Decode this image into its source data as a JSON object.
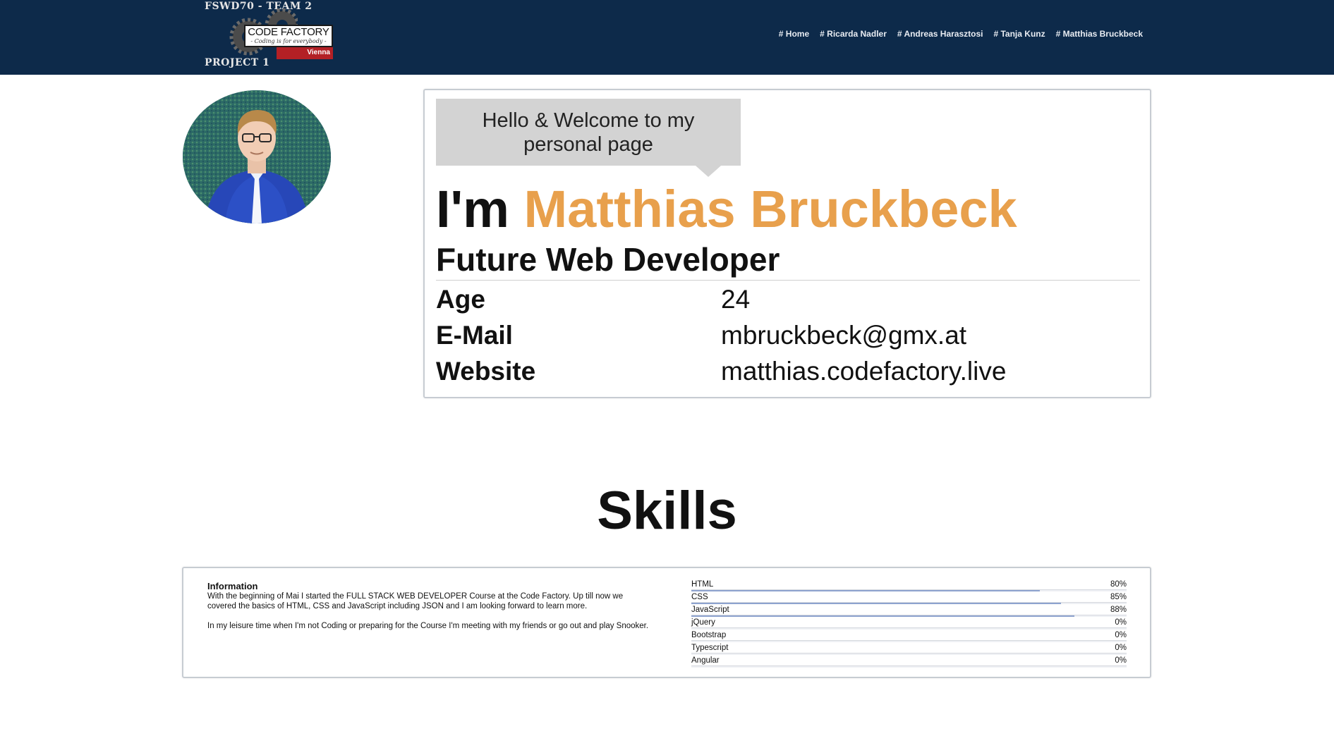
{
  "header": {
    "logo": {
      "top_text": "FSWD70 - TEAM 2",
      "card_title": "CODE FACTORY",
      "card_subtitle": "- Coding is for everybody -",
      "bar_text": "Vienna",
      "bottom_text": "PROJECT 1"
    },
    "nav": [
      {
        "label": "# Home"
      },
      {
        "label": "# Ricarda Nadler"
      },
      {
        "label": "# Andreas Harasztosi"
      },
      {
        "label": "# Tanja Kunz"
      },
      {
        "label": "# Matthias Bruckbeck"
      }
    ],
    "colors": {
      "background": "#0d2a4a",
      "logo_red": "#b32025"
    }
  },
  "profile": {
    "bubble_line1": "Hello & Welcome to my",
    "bubble_line2": "personal page",
    "greeting": "I'm",
    "name": "Matthias Bruckbeck",
    "title": "Future Web Developer",
    "details": [
      {
        "label": "Age",
        "value": "24"
      },
      {
        "label": "E-Mail",
        "value": "mbruckbeck@gmx.at"
      },
      {
        "label": "Website",
        "value": "matthias.codefactory.live"
      }
    ],
    "colors": {
      "name": "#e8a04c"
    }
  },
  "skills": {
    "title": "Skills",
    "info_heading": "Information",
    "info_paragraphs": [
      "With the beginning of Mai I started the FULL STACK WEB DEVELOPER Course at the Code Factory. Up till now we covered the basics of HTML, CSS and JavaScript including JSON and I am looking forward to learn more.",
      "In my leisure time when I'm not Coding or preparing for the Course I'm meeting with my friends or go out and play Snooker."
    ],
    "items": [
      {
        "name": "HTML",
        "percent": "80%",
        "level": 0.8
      },
      {
        "name": "CSS",
        "percent": "85%",
        "level": 0.85
      },
      {
        "name": "JavaScript",
        "percent": "88%",
        "level": 0.88
      },
      {
        "name": "jQuery",
        "percent": "0%",
        "level": 0
      },
      {
        "name": "Bootstrap",
        "percent": "0%",
        "level": 0
      },
      {
        "name": "Typescript",
        "percent": "0%",
        "level": 0
      },
      {
        "name": "Angular",
        "percent": "0%",
        "level": 0
      }
    ],
    "colors": {
      "bar_fill": "#8ea3cf"
    }
  }
}
